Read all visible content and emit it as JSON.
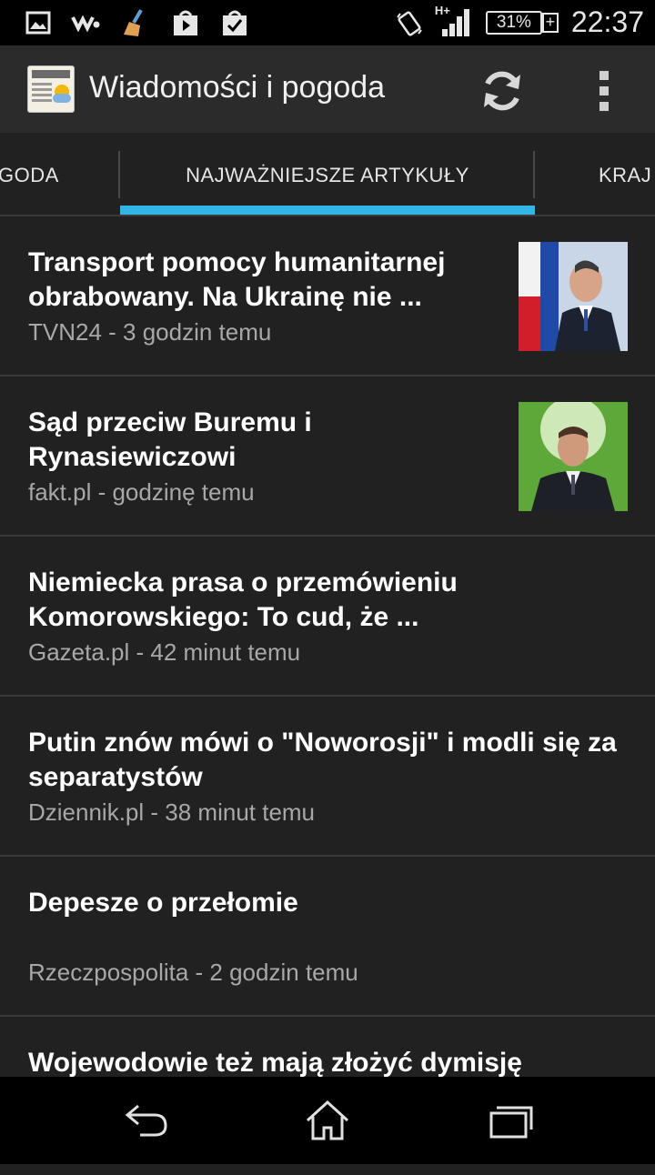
{
  "status_bar": {
    "battery": "31%",
    "clock": "22:37",
    "network": "H+",
    "icons": [
      "image-icon",
      "walkman-icon",
      "cleaner-icon",
      "play-store-icon",
      "task-icon",
      "vibrate-icon",
      "signal-icon",
      "battery-icon"
    ]
  },
  "action_bar": {
    "title": "Wiadomości i pogoda",
    "icons": [
      "app-logo-icon",
      "refresh-icon",
      "overflow-menu-icon"
    ]
  },
  "tabs": {
    "left": "GODA",
    "active": "NAJWAŻNIEJSZE ARTYKUŁY",
    "right": "KRAJ"
  },
  "articles": [
    {
      "headline": "Transport pomocy humanitarnej obrabowany. Na Ukrainę nie ...",
      "source": "TVN24 - 3 godzin temu"
    },
    {
      "headline": "Sąd przeciw Buremu i Rynasiewiczowi",
      "source": "fakt.pl - godzinę temu"
    },
    {
      "headline": "Niemiecka prasa o przemówieniu Komorowskiego: To cud, że ...",
      "source": "Gazeta.pl - 42 minut temu"
    },
    {
      "headline": "Putin znów mówi o \"Noworosji\" i modli się za separatystów",
      "source": "Dziennik.pl - 38 minut temu"
    },
    {
      "headline": "Depesze o przełomie",
      "source": "Rzeczpospolita - 2 godzin temu"
    },
    {
      "headline": "Wojewodowie też mają złożyć dymisję",
      "source": ""
    }
  ],
  "nav_bar": {
    "icons": [
      "back-icon",
      "home-icon",
      "recent-apps-icon"
    ]
  },
  "colors": {
    "background": "#212121",
    "accent": "#33b5e5",
    "action_bar": "#2b2b2b"
  }
}
